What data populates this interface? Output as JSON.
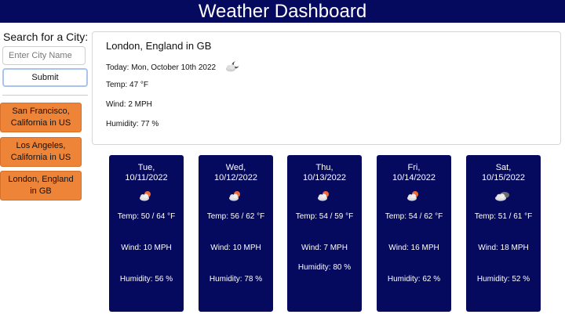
{
  "header": {
    "title": "Weather Dashboard"
  },
  "search": {
    "label": "Search for a City:",
    "placeholder": "Enter City Name",
    "submit_label": "Submit"
  },
  "history": [
    {
      "label": "San Francisco, California in US"
    },
    {
      "label": "Los Angeles, California in US"
    },
    {
      "label": "London, England in GB"
    }
  ],
  "current": {
    "city": "London, England in GB",
    "today": "Today: Mon, October 10th 2022",
    "icon": "partly-cloudy-night-icon",
    "temp": "Temp: 47 °F",
    "wind": "Wind: 2 MPH",
    "humidity": "Humidity: 77 %"
  },
  "forecast": [
    {
      "day": "Tue,",
      "date": "10/11/2022",
      "icon": "partly-cloudy-day-icon",
      "temp": "Temp: 50 / 64 °F",
      "wind": "Wind: 10 MPH",
      "humidity": "Humidity: 56 %"
    },
    {
      "day": "Wed,",
      "date": "10/12/2022",
      "icon": "partly-cloudy-day-icon",
      "temp": "Temp: 56 / 62 °F",
      "wind": "Wind: 10 MPH",
      "humidity": "Humidity: 78 %"
    },
    {
      "day": "Thu,",
      "date": "10/13/2022",
      "icon": "partly-cloudy-day-icon",
      "temp": "Temp: 54 / 59 °F",
      "wind": "Wind: 7 MPH",
      "humidity": "Humidity: 80 %"
    },
    {
      "day": "Fri,",
      "date": "10/14/2022",
      "icon": "partly-cloudy-day-icon",
      "temp": "Temp: 54 / 62 °F",
      "wind": "Wind: 16 MPH",
      "humidity": "Humidity: 62 %"
    },
    {
      "day": "Sat,",
      "date": "10/15/2022",
      "icon": "cloudy-icon",
      "temp": "Temp: 51 / 61 °F",
      "wind": "Wind: 18 MPH",
      "humidity": "Humidity: 52 %"
    }
  ],
  "colors": {
    "header": "#050a5e",
    "card": "#050a5e",
    "history": "#ee8437"
  }
}
